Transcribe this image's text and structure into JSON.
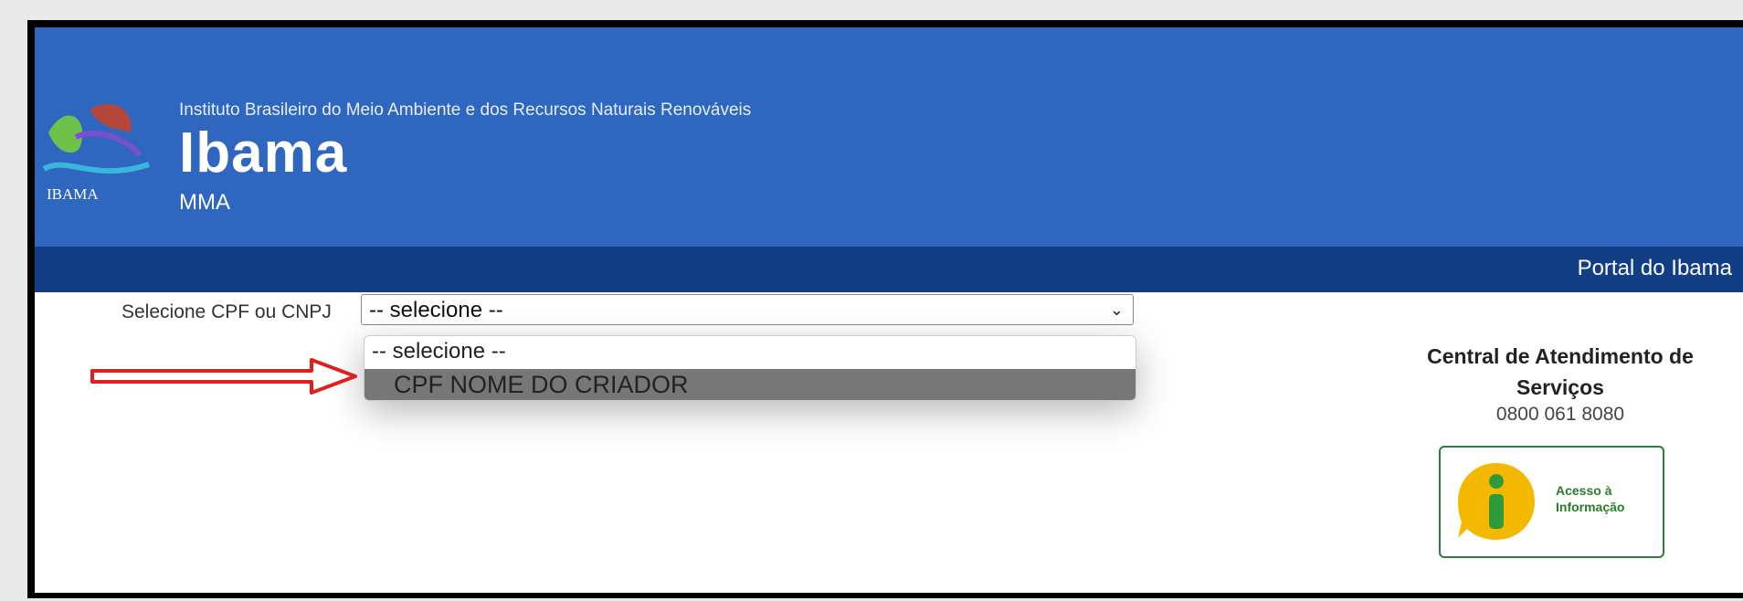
{
  "header": {
    "org_name": "Instituto Brasileiro do Meio Ambiente e dos Recursos Naturais Renováveis",
    "org_short": "Ibama",
    "org_sub": "MMA",
    "logo_text": "IBAMA"
  },
  "navbar": {
    "portal_link": "Portal do Ibama"
  },
  "form": {
    "select_label": "Selecione CPF ou CNPJ",
    "selected_value": "-- selecione --",
    "options": [
      "-- selecione --",
      "CPF NOME DO CRIADOR"
    ]
  },
  "central": {
    "title": "Central de Atendimento de Serviços",
    "phone": "0800 061 8080"
  },
  "access": {
    "label": "Acesso à Informação"
  },
  "colors": {
    "header_bg": "#2f66c0",
    "navbar_bg": "#123e85",
    "highlight_option": "#777777",
    "arrow": "#e02020"
  }
}
